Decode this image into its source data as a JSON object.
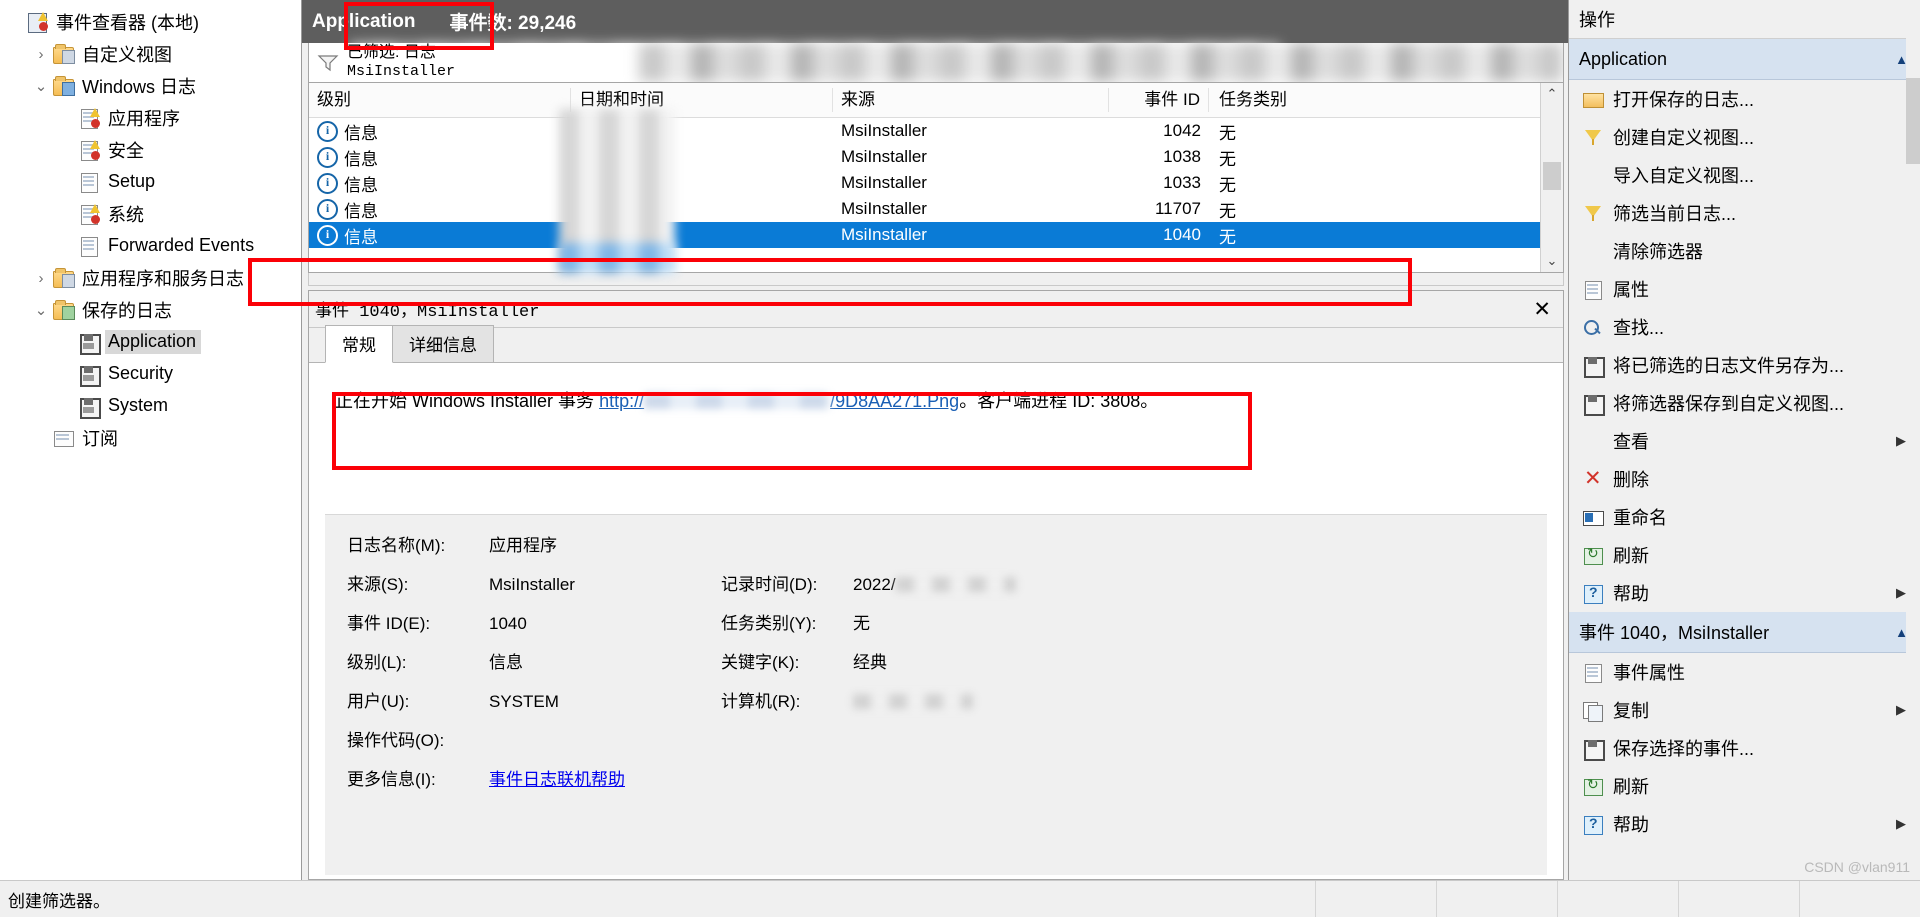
{
  "tree": {
    "nodes": [
      {
        "label": "事件查看器 (本地)",
        "indent": 0,
        "twist": "",
        "icon": "root",
        "selected": false
      },
      {
        "label": "自定义视图",
        "indent": 1,
        "twist": "›",
        "icon": "folder-filter",
        "selected": false
      },
      {
        "label": "Windows 日志",
        "indent": 1,
        "twist": "⌄",
        "icon": "folder-blue",
        "selected": false
      },
      {
        "label": "应用程序",
        "indent": 2,
        "twist": "",
        "icon": "log-warn",
        "selected": false
      },
      {
        "label": "安全",
        "indent": 2,
        "twist": "",
        "icon": "log-warn",
        "selected": false
      },
      {
        "label": "Setup",
        "indent": 2,
        "twist": "",
        "icon": "log-plain",
        "selected": false
      },
      {
        "label": "系统",
        "indent": 2,
        "twist": "",
        "icon": "log-warn",
        "selected": false
      },
      {
        "label": "Forwarded Events",
        "indent": 2,
        "twist": "",
        "icon": "log-plain",
        "selected": false
      },
      {
        "label": "应用程序和服务日志",
        "indent": 1,
        "twist": "›",
        "icon": "folder-plain",
        "selected": false
      },
      {
        "label": "保存的日志",
        "indent": 1,
        "twist": "⌄",
        "icon": "folder-green",
        "selected": false
      },
      {
        "label": "Application",
        "indent": 2,
        "twist": "",
        "icon": "disk",
        "selected": true
      },
      {
        "label": "Security",
        "indent": 2,
        "twist": "",
        "icon": "disk",
        "selected": false
      },
      {
        "label": "System",
        "indent": 2,
        "twist": "",
        "icon": "disk",
        "selected": false
      },
      {
        "label": "订阅",
        "indent": 1,
        "twist": "",
        "icon": "subscription",
        "selected": false
      }
    ]
  },
  "center": {
    "header": {
      "title": "Application",
      "count_label": "事件数: 29,246"
    },
    "filter": {
      "line1": "已筛选: 日志",
      "line2": "MsiInstaller",
      "icon": "funnel-icon"
    },
    "columns": {
      "level": "级别",
      "date": "日期和时间",
      "source": "来源",
      "event_id": "事件 ID",
      "task": "任务类别"
    },
    "rows": [
      {
        "level": "信息",
        "date": "2022/",
        "source": "MsiInstaller",
        "event_id": "1042",
        "task": "无",
        "selected": false
      },
      {
        "level": "信息",
        "date": "2022/",
        "source": "MsiInstaller",
        "event_id": "1038",
        "task": "无",
        "selected": false
      },
      {
        "level": "信息",
        "date": "2022/",
        "source": "MsiInstaller",
        "event_id": "1033",
        "task": "无",
        "selected": false
      },
      {
        "level": "信息",
        "date": "2022/",
        "source": "MsiInstaller",
        "event_id": "11707",
        "task": "无",
        "selected": false
      },
      {
        "level": "信息",
        "date": "2022/",
        "source": "MsiInstaller",
        "event_id": "1040",
        "task": "无",
        "selected": true
      }
    ],
    "detail": {
      "title": "事件 1040，MsiInstaller",
      "close": "✕",
      "tabs": [
        {
          "label": "常规",
          "active": true
        },
        {
          "label": "详细信息",
          "active": false
        }
      ],
      "message_pre": "正在开始 Windows Installer 事务 ",
      "message_link_pre": "http://",
      "message_link_post": "/9D8AA271.Png",
      "message_post": "。客户端进程 ID: 3808。",
      "fields": {
        "log_name_label": "日志名称(M):",
        "log_name_value": "应用程序",
        "source_label": "来源(S):",
        "source_value": "MsiInstaller",
        "logged_label": "记录时间(D):",
        "logged_value": "2022/",
        "event_id_label": "事件 ID(E):",
        "event_id_value": "1040",
        "task_label": "任务类别(Y):",
        "task_value": "无",
        "level_label": "级别(L):",
        "level_value": "信息",
        "keywords_label": "关键字(K):",
        "keywords_value": "经典",
        "user_label": "用户(U):",
        "user_value": "SYSTEM",
        "computer_label": "计算机(R):",
        "computer_value": "",
        "opcode_label": "操作代码(O):",
        "opcode_value": "",
        "more_info_label": "更多信息(I):",
        "more_info_link": "事件日志联机帮助"
      }
    }
  },
  "actions": {
    "title": "操作",
    "sections": [
      {
        "title": "Application",
        "caret": "▲",
        "items": [
          {
            "label": "打开保存的日志...",
            "icon": "open-log-icon",
            "submenu": false
          },
          {
            "label": "创建自定义视图...",
            "icon": "funnel-icon",
            "submenu": false
          },
          {
            "label": "导入自定义视图...",
            "icon": "blank-icon",
            "submenu": false
          },
          {
            "label": "筛选当前日志...",
            "icon": "funnel-icon",
            "submenu": false
          },
          {
            "label": "清除筛选器",
            "icon": "blank-icon",
            "submenu": false
          },
          {
            "label": "属性",
            "icon": "properties-icon",
            "submenu": false
          },
          {
            "label": "查找...",
            "icon": "find-icon",
            "submenu": false
          },
          {
            "label": "将已筛选的日志文件另存为...",
            "icon": "save-icon",
            "submenu": false
          },
          {
            "label": "将筛选器保存到自定义视图...",
            "icon": "save-icon",
            "submenu": false
          },
          {
            "label": "查看",
            "icon": "blank-icon",
            "submenu": true
          },
          {
            "label": "删除",
            "icon": "delete-icon",
            "submenu": false
          },
          {
            "label": "重命名",
            "icon": "rename-icon",
            "submenu": false
          },
          {
            "label": "刷新",
            "icon": "refresh-icon",
            "submenu": false
          },
          {
            "label": "帮助",
            "icon": "help-icon",
            "submenu": true
          }
        ]
      },
      {
        "title": "事件 1040，MsiInstaller",
        "caret": "▲",
        "items": [
          {
            "label": "事件属性",
            "icon": "properties-icon",
            "submenu": false
          },
          {
            "label": "复制",
            "icon": "copy-icon",
            "submenu": true
          },
          {
            "label": "保存选择的事件...",
            "icon": "save-icon",
            "submenu": false
          },
          {
            "label": "刷新",
            "icon": "refresh-icon",
            "submenu": false
          },
          {
            "label": "帮助",
            "icon": "help-icon",
            "submenu": true
          }
        ]
      }
    ]
  },
  "status": {
    "text": "创建筛选器。"
  },
  "watermark": "CSDN @vlan911",
  "colors": {
    "accent": "#0a7bd6",
    "annotation": "#fb0007",
    "header_bg": "#5e5e5e",
    "section_bg": "#d6e2f0"
  }
}
